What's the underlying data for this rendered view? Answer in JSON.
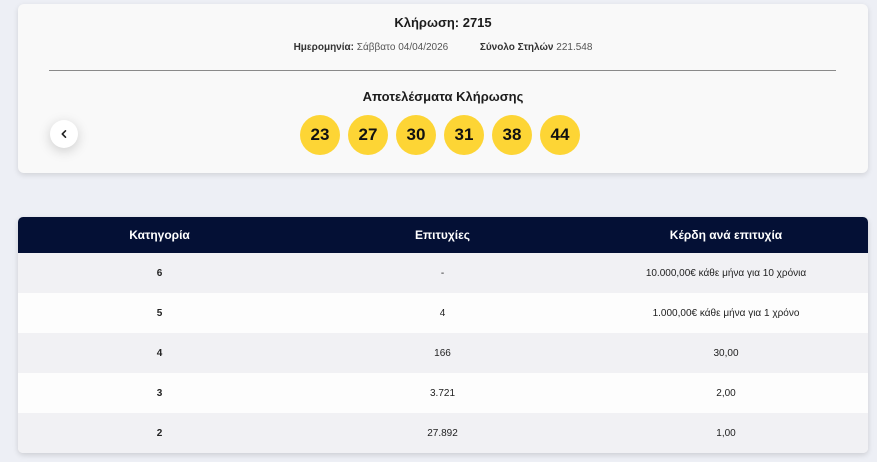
{
  "draw": {
    "title": "Κλήρωση: 2715",
    "date_label": "Ημερομηνία:",
    "date_value": "Σάββατο 04/04/2026",
    "columns_label": "Σύνολο Στηλών",
    "columns_value": "221.548",
    "results_title": "Αποτελέσματα Κλήρωσης",
    "prev_icon": "chevron-left-icon",
    "numbers": [
      "23",
      "27",
      "30",
      "31",
      "38",
      "44"
    ]
  },
  "colors": {
    "ball": "#fdd535",
    "header_bg": "#041035",
    "page_bg": "#edeff5"
  },
  "table": {
    "headers": [
      "Κατηγορία",
      "Επιτυχίες",
      "Κέρδη ανά επιτυχία"
    ],
    "rows": [
      {
        "category": "6",
        "winners": "-",
        "prize": "10.000,00€ κάθε μήνα για 10 χρόνια"
      },
      {
        "category": "5",
        "winners": "4",
        "prize": "1.000,00€ κάθε μήνα για 1 χρόνο"
      },
      {
        "category": "4",
        "winners": "166",
        "prize": "30,00"
      },
      {
        "category": "3",
        "winners": "3.721",
        "prize": "2,00"
      },
      {
        "category": "2",
        "winners": "27.892",
        "prize": "1,00"
      }
    ]
  }
}
